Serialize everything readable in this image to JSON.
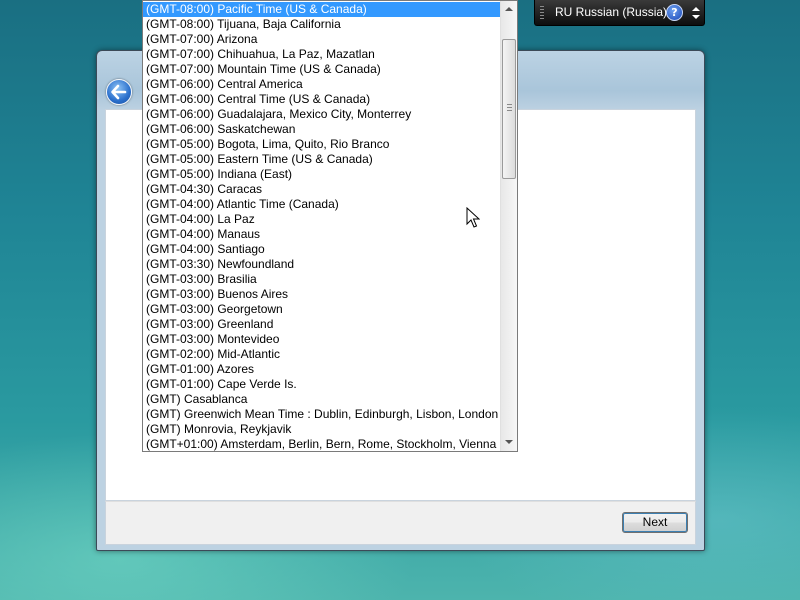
{
  "language_bar": {
    "label": "RU Russian (Russia)",
    "help_symbol": "?",
    "icons": [
      "help-icon",
      "options-arrows-icon"
    ]
  },
  "window": {
    "back_icon": "back-arrow-icon",
    "next_label": "Next"
  },
  "timezone_list": {
    "selected_index": 0,
    "items": [
      "(GMT-08:00) Pacific Time (US & Canada)",
      "(GMT-08:00) Tijuana, Baja California",
      "(GMT-07:00) Arizona",
      "(GMT-07:00) Chihuahua, La Paz, Mazatlan",
      "(GMT-07:00) Mountain Time (US & Canada)",
      "(GMT-06:00) Central America",
      "(GMT-06:00) Central Time (US & Canada)",
      "(GMT-06:00) Guadalajara, Mexico City, Monterrey",
      "(GMT-06:00) Saskatchewan",
      "(GMT-05:00) Bogota, Lima, Quito, Rio Branco",
      "(GMT-05:00) Eastern Time (US & Canada)",
      "(GMT-05:00) Indiana (East)",
      "(GMT-04:30) Caracas",
      "(GMT-04:00) Atlantic Time (Canada)",
      "(GMT-04:00) La Paz",
      "(GMT-04:00) Manaus",
      "(GMT-04:00) Santiago",
      "(GMT-03:30) Newfoundland",
      "(GMT-03:00) Brasilia",
      "(GMT-03:00) Buenos Aires",
      "(GMT-03:00) Georgetown",
      "(GMT-03:00) Greenland",
      "(GMT-03:00) Montevideo",
      "(GMT-02:00) Mid-Atlantic",
      "(GMT-01:00) Azores",
      "(GMT-01:00) Cape Verde Is.",
      "(GMT) Casablanca",
      "(GMT) Greenwich Mean Time : Dublin, Edinburgh, Lisbon, London",
      "(GMT) Monrovia, Reykjavik",
      "(GMT+01:00) Amsterdam, Berlin, Bern, Rome, Stockholm, Vienna"
    ]
  },
  "colors": {
    "selection": "#3399ff",
    "desktop": "#1f8495"
  }
}
